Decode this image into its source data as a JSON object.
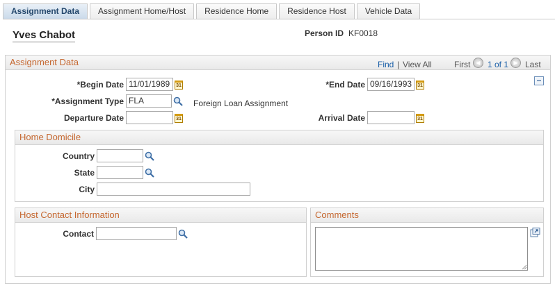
{
  "tabs": [
    {
      "label": "Assignment Data",
      "active": true
    },
    {
      "label": "Assignment Home/Host",
      "active": false
    },
    {
      "label": "Residence Home",
      "active": false
    },
    {
      "label": "Residence Host",
      "active": false
    },
    {
      "label": "Vehicle Data",
      "active": false
    }
  ],
  "person": {
    "name": "Yves Chabot",
    "id_label": "Person ID",
    "id_value": "KF0018"
  },
  "assignment": {
    "title": "Assignment Data",
    "nav": {
      "find": "Find",
      "separator": "|",
      "view_all": "View All",
      "first": "First",
      "range": "1 of 1",
      "last": "Last"
    },
    "begin_date_label": "*Begin Date",
    "begin_date": "11/01/1989",
    "end_date_label": "*End Date",
    "end_date": "09/16/1993",
    "type_label": "*Assignment Type",
    "type_value": "FLA",
    "type_description": "Foreign Loan Assignment",
    "departure_label": "Departure Date",
    "departure_value": "",
    "arrival_label": "Arrival Date",
    "arrival_value": ""
  },
  "home_domicile": {
    "title": "Home Domicile",
    "country_label": "Country",
    "country_value": "",
    "state_label": "State",
    "state_value": "",
    "city_label": "City",
    "city_value": ""
  },
  "host_contact": {
    "title": "Host Contact Information",
    "contact_label": "Contact",
    "contact_value": ""
  },
  "comments": {
    "title": "Comments",
    "value": ""
  },
  "colors": {
    "section_title": "#c5672f",
    "link": "#1a5fa8",
    "active_tab_text": "#24486d"
  },
  "icons": {
    "calendar": "calendar-icon",
    "lookup": "magnifier-icon",
    "collapse": "collapse-minus-icon",
    "expand_textarea": "expand-icon"
  }
}
